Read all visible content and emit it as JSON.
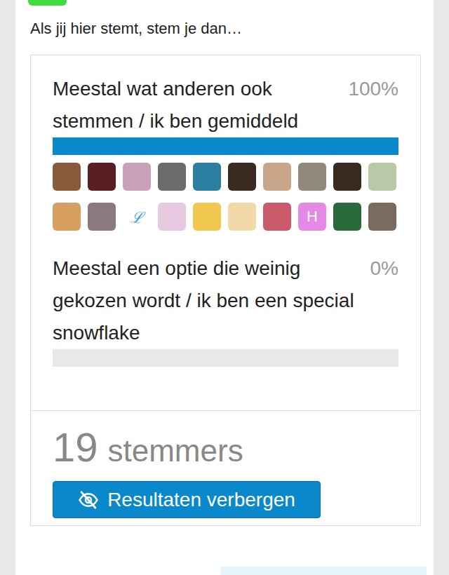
{
  "question": "Als jij hier stemt, stem je dan…",
  "options": [
    {
      "label": "Meestal wat anderen ook stemmen / ik ben gemiddeld",
      "percent": "100%",
      "level": 1,
      "voters": [
        {
          "kind": "photo",
          "color": "#8a5a3c"
        },
        {
          "kind": "photo",
          "color": "#5a1f24"
        },
        {
          "kind": "photo",
          "color": "#c8a0b8"
        },
        {
          "kind": "photo",
          "color": "#6d6a6a"
        },
        {
          "kind": "photo",
          "color": "#2a7fa0"
        },
        {
          "kind": "photo",
          "color": "#3b2a22"
        },
        {
          "kind": "photo",
          "color": "#c9a58a"
        },
        {
          "kind": "photo",
          "color": "#8f8a7a"
        },
        {
          "kind": "photo",
          "color": "#3a2a20"
        },
        {
          "kind": "photo",
          "color": "#b9c9a8"
        },
        {
          "kind": "photo",
          "color": "#d8a060"
        },
        {
          "kind": "photo",
          "color": "#8a7a80"
        },
        {
          "kind": "letter",
          "text": "ℒ",
          "color": "#ffffff"
        },
        {
          "kind": "photo",
          "color": "#e6c8e0"
        },
        {
          "kind": "photo",
          "color": "#f0c850"
        },
        {
          "kind": "photo",
          "color": "#f2d9a8"
        },
        {
          "kind": "photo",
          "color": "#c85a6a"
        },
        {
          "kind": "letter",
          "text": "H",
          "color": "#e48ae6"
        },
        {
          "kind": "photo",
          "color": "#2a6a3a"
        },
        {
          "kind": "photo",
          "color": "#7a6a60"
        }
      ]
    },
    {
      "label": "Meestal een optie die weinig gekozen wordt / ik ben een special snowflake",
      "percent": "0%",
      "level": 0,
      "voters": []
    }
  ],
  "voter_count": "19",
  "voter_label": "stemmers",
  "button": {
    "label": "Resultaten verbergen"
  }
}
